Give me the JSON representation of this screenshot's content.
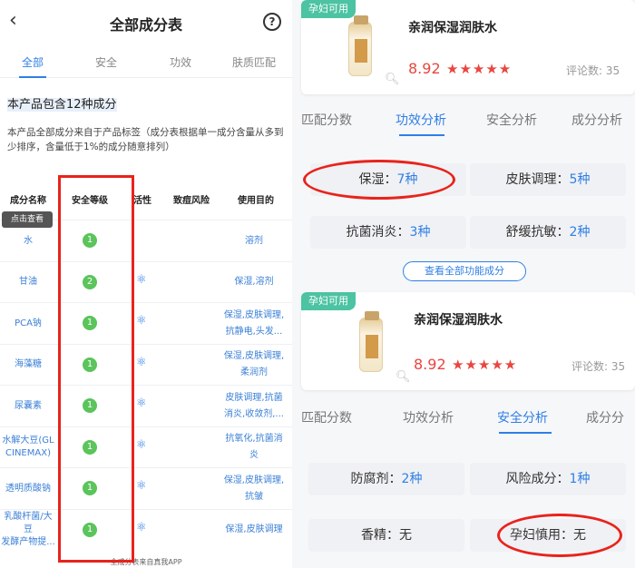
{
  "left": {
    "back_icon": "chevron-left-icon",
    "title": "全部成分表",
    "help_icon": "help-circle-icon",
    "help_glyph": "?",
    "tabs": [
      "全部",
      "安全",
      "功效",
      "肤质匹配"
    ],
    "count_text": "本产品包含12种成分",
    "description": "本产品全部成分来自于产品标签（成分表根据单一成分含量从多到少排序，含量低于1%的成分随意排列）",
    "columns": [
      "成分名称",
      "安全等级",
      "活性",
      "致痘风险",
      "使用目的"
    ],
    "tooltip": "点击查看",
    "rows": [
      {
        "name": "水",
        "level": "1",
        "active": false,
        "purpose": "溶剂"
      },
      {
        "name": "甘油",
        "level": "2",
        "active": true,
        "purpose": "保湿,溶剂"
      },
      {
        "name": "PCA钠",
        "level": "1",
        "active": true,
        "purpose": "保湿,皮肤调理,\n抗静电,头发..."
      },
      {
        "name": "海藻糖",
        "level": "1",
        "active": true,
        "purpose": "保湿,皮肤调理,\n柔润剂"
      },
      {
        "name": "尿囊素",
        "level": "1",
        "active": true,
        "purpose": "皮肤调理,抗菌\n消炎,收敛剂,..."
      },
      {
        "name": "水解大豆(GL\nCINEMAX)",
        "level": "1",
        "active": true,
        "purpose": "抗氧化,抗菌消\n炎"
      },
      {
        "name": "透明质酸钠",
        "level": "1",
        "active": true,
        "purpose": "保湿,皮肤调理,\n抗皱"
      },
      {
        "name": "乳酸杆菌/大豆\n发酵产物提...",
        "level": "1",
        "active": true,
        "purpose": "保湿,皮肤调理"
      }
    ],
    "active_icon": "dna-icon",
    "footer": "全成分表来自真我APP",
    "colors": {
      "accent": "#2f7fe6",
      "badge": "#5bc45b",
      "highlight": "#e8231c"
    }
  },
  "right": {
    "pregnancy_badge": "孕妇可用",
    "product_name": "亲润保湿润肤水",
    "score": "8.92",
    "stars": "★★★★★",
    "review_label": "评论数: 35",
    "search_icon": "magnifier-icon",
    "tabs": [
      "匹配分数",
      "功效分析",
      "安全分析",
      "成分分析"
    ],
    "tabs_cut": [
      "匹配分数",
      "功效分析",
      "安全分析",
      "成分分"
    ],
    "efficacy": [
      {
        "label": "保湿：",
        "value": "7种"
      },
      {
        "label": "皮肤调理：",
        "value": "5种"
      },
      {
        "label": "抗菌消炎：",
        "value": "3种"
      },
      {
        "label": "舒缓抗敏：",
        "value": "2种"
      }
    ],
    "more_button": "查看全部功能成分",
    "safety": [
      {
        "label": "防腐剂：",
        "value": "2种"
      },
      {
        "label": "风险成分：",
        "value": "1种"
      },
      {
        "label": "香精：",
        "value": "无"
      },
      {
        "label": "孕妇慎用：",
        "value": "无"
      }
    ],
    "colors": {
      "accent": "#2f7fe6",
      "badge": "#4cc3a2",
      "score": "#e8463f"
    }
  }
}
